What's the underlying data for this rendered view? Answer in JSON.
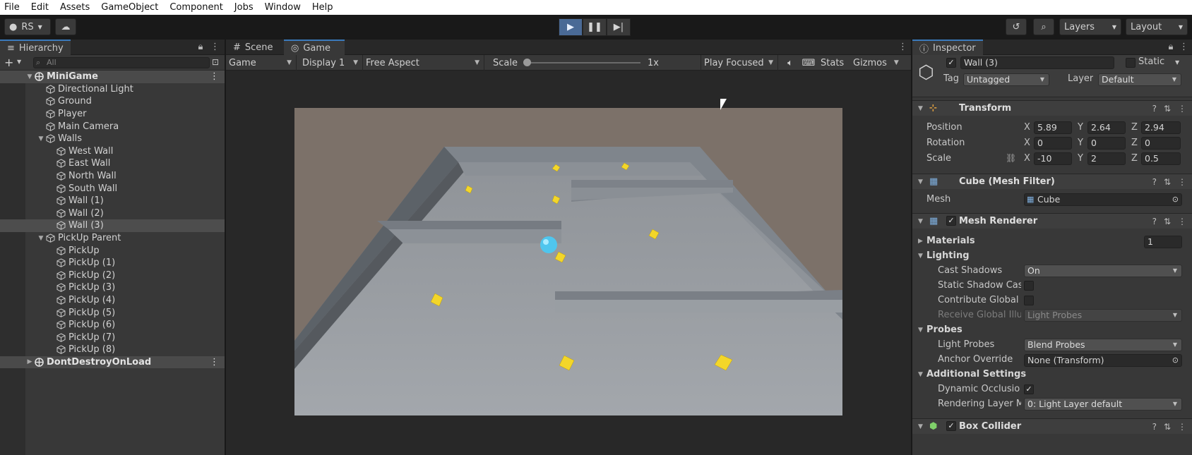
{
  "menu": [
    "File",
    "Edit",
    "Assets",
    "GameObject",
    "Component",
    "Jobs",
    "Window",
    "Help"
  ],
  "toolbar": {
    "account": "RS",
    "layers": "Layers",
    "layout": "Layout"
  },
  "hierarchy": {
    "tab": "Hierarchy",
    "search_placeholder": "All",
    "rows": [
      {
        "label": "MiniGame",
        "depth": 0,
        "type": "scene",
        "expanded": true
      },
      {
        "label": "Directional Light",
        "depth": 1
      },
      {
        "label": "Ground",
        "depth": 1
      },
      {
        "label": "Player",
        "depth": 1
      },
      {
        "label": "Main Camera",
        "depth": 1
      },
      {
        "label": "Walls",
        "depth": 1,
        "expanded": true
      },
      {
        "label": "West Wall",
        "depth": 2
      },
      {
        "label": "East Wall",
        "depth": 2
      },
      {
        "label": "North Wall",
        "depth": 2
      },
      {
        "label": "South Wall",
        "depth": 2
      },
      {
        "label": "Wall (1)",
        "depth": 2
      },
      {
        "label": "Wall (2)",
        "depth": 2
      },
      {
        "label": "Wall (3)",
        "depth": 2,
        "selected": true
      },
      {
        "label": "PickUp Parent",
        "depth": 1,
        "expanded": true
      },
      {
        "label": "PickUp",
        "depth": 2
      },
      {
        "label": "PickUp (1)",
        "depth": 2
      },
      {
        "label": "PickUp (2)",
        "depth": 2
      },
      {
        "label": "PickUp (3)",
        "depth": 2
      },
      {
        "label": "PickUp (4)",
        "depth": 2
      },
      {
        "label": "PickUp (5)",
        "depth": 2
      },
      {
        "label": "PickUp (6)",
        "depth": 2
      },
      {
        "label": "PickUp (7)",
        "depth": 2
      },
      {
        "label": "PickUp (8)",
        "depth": 2
      },
      {
        "label": "DontDestroyOnLoad",
        "depth": 0,
        "type": "scene",
        "expanded": false
      }
    ]
  },
  "game": {
    "tab_scene": "Scene",
    "tab_game": "Game",
    "mode": "Game",
    "display": "Display 1",
    "aspect": "Free Aspect",
    "scale_label": "Scale",
    "scale_value": "1x",
    "play_mode": "Play Focused",
    "stats": "Stats",
    "gizmos": "Gizmos"
  },
  "inspector": {
    "tab": "Inspector",
    "object_name": "Wall (3)",
    "static_label": "Static",
    "tag_label": "Tag",
    "tag_value": "Untagged",
    "layer_label": "Layer",
    "layer_value": "Default",
    "transform": {
      "title": "Transform",
      "position_label": "Position",
      "rotation_label": "Rotation",
      "scale_label": "Scale",
      "position": {
        "x": "5.89",
        "y": "2.64",
        "z": "2.94"
      },
      "rotation": {
        "x": "0",
        "y": "0",
        "z": "0"
      },
      "scale": {
        "x": "-10",
        "y": "2",
        "z": "0.5"
      }
    },
    "mesh_filter": {
      "title": "Cube (Mesh Filter)",
      "mesh_label": "Mesh",
      "mesh_value": "Cube"
    },
    "mesh_renderer": {
      "title": "Mesh Renderer",
      "materials_label": "Materials",
      "materials_count": "1",
      "lighting_label": "Lighting",
      "cast_shadows_label": "Cast Shadows",
      "cast_shadows_value": "On",
      "static_shadow_label": "Static Shadow Cas",
      "contribute_gi_label": "Contribute Global I",
      "receive_gi_label": "Receive Global Illu",
      "receive_gi_value": "Light Probes",
      "probes_label": "Probes",
      "light_probes_label": "Light Probes",
      "light_probes_value": "Blend Probes",
      "anchor_label": "Anchor Override",
      "anchor_value": "None (Transform)",
      "additional_label": "Additional Settings",
      "dynamic_occlusion_label": "Dynamic Occlusio",
      "rendering_layer_label": "Rendering Layer M",
      "rendering_layer_value": "0: Light Layer default"
    },
    "box_collider": {
      "title": "Box Collider"
    }
  }
}
